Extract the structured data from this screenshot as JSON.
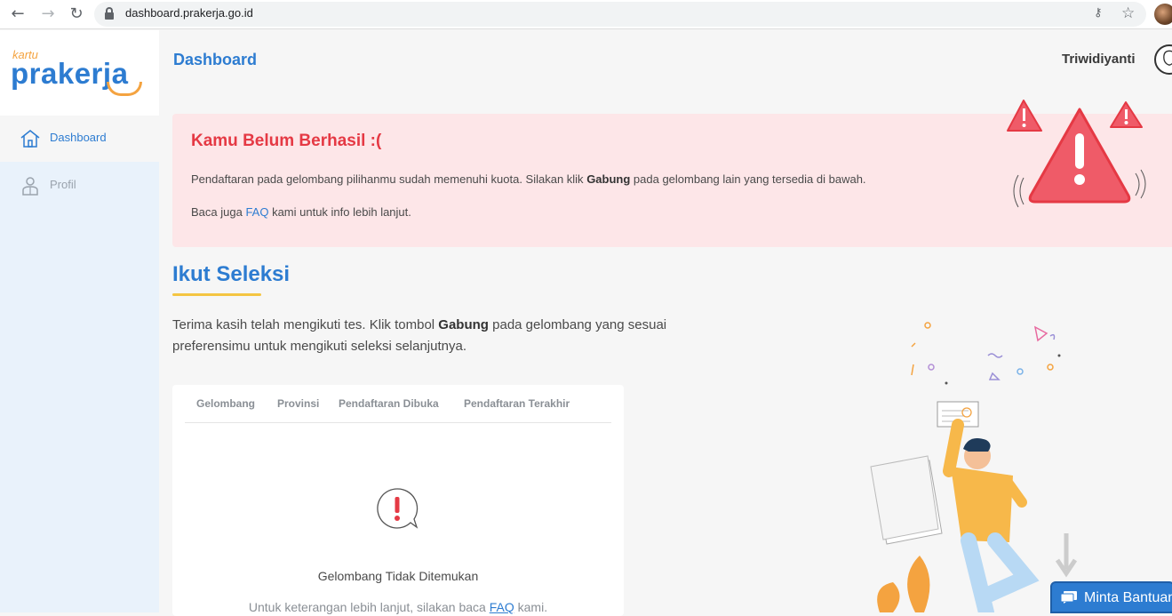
{
  "browser": {
    "url": "dashboard.prakerja.go.id"
  },
  "sidebar": {
    "logo_small": "kartu",
    "logo_big": "prakerja",
    "items": [
      {
        "label": "Dashboard",
        "icon": "home-icon",
        "active": true
      },
      {
        "label": "Profil",
        "icon": "user-icon",
        "active": false
      }
    ]
  },
  "header": {
    "title": "Dashboard",
    "user_name": "Triwidiyanti"
  },
  "alert": {
    "title": "Kamu Belum Berhasil :(",
    "text_before": "Pendaftaran pada gelombang pilihanmu sudah memenuhi kuota. Silakan klik ",
    "text_bold": "Gabung",
    "text_after": " pada gelombang lain yang tersedia di bawah.",
    "text2_before": "Baca juga ",
    "text2_link": "FAQ",
    "text2_after": " kami untuk info lebih lanjut."
  },
  "section": {
    "title": "Ikut Seleksi",
    "desc_before": "Terima kasih telah mengikuti tes. Klik tombol ",
    "desc_bold": "Gabung",
    "desc_after": " pada gelombang yang sesuai preferensimu untuk mengikuti seleksi selanjutnya."
  },
  "table": {
    "columns": [
      "Gelombang",
      "Provinsi",
      "Pendaftaran Dibuka",
      "Pendaftaran Terakhir"
    ],
    "empty_title": "Gelombang Tidak Ditemukan",
    "empty_sub_before": "Untuk keterangan lebih lanjut, silakan baca ",
    "empty_sub_link": "FAQ",
    "empty_sub_after": " kami."
  },
  "help": {
    "label": "Minta Bantuan"
  },
  "colors": {
    "brand_blue": "#2d7cd1",
    "brand_orange": "#f4a340",
    "alert_red": "#e53944",
    "alert_bg": "#fde6e8"
  }
}
